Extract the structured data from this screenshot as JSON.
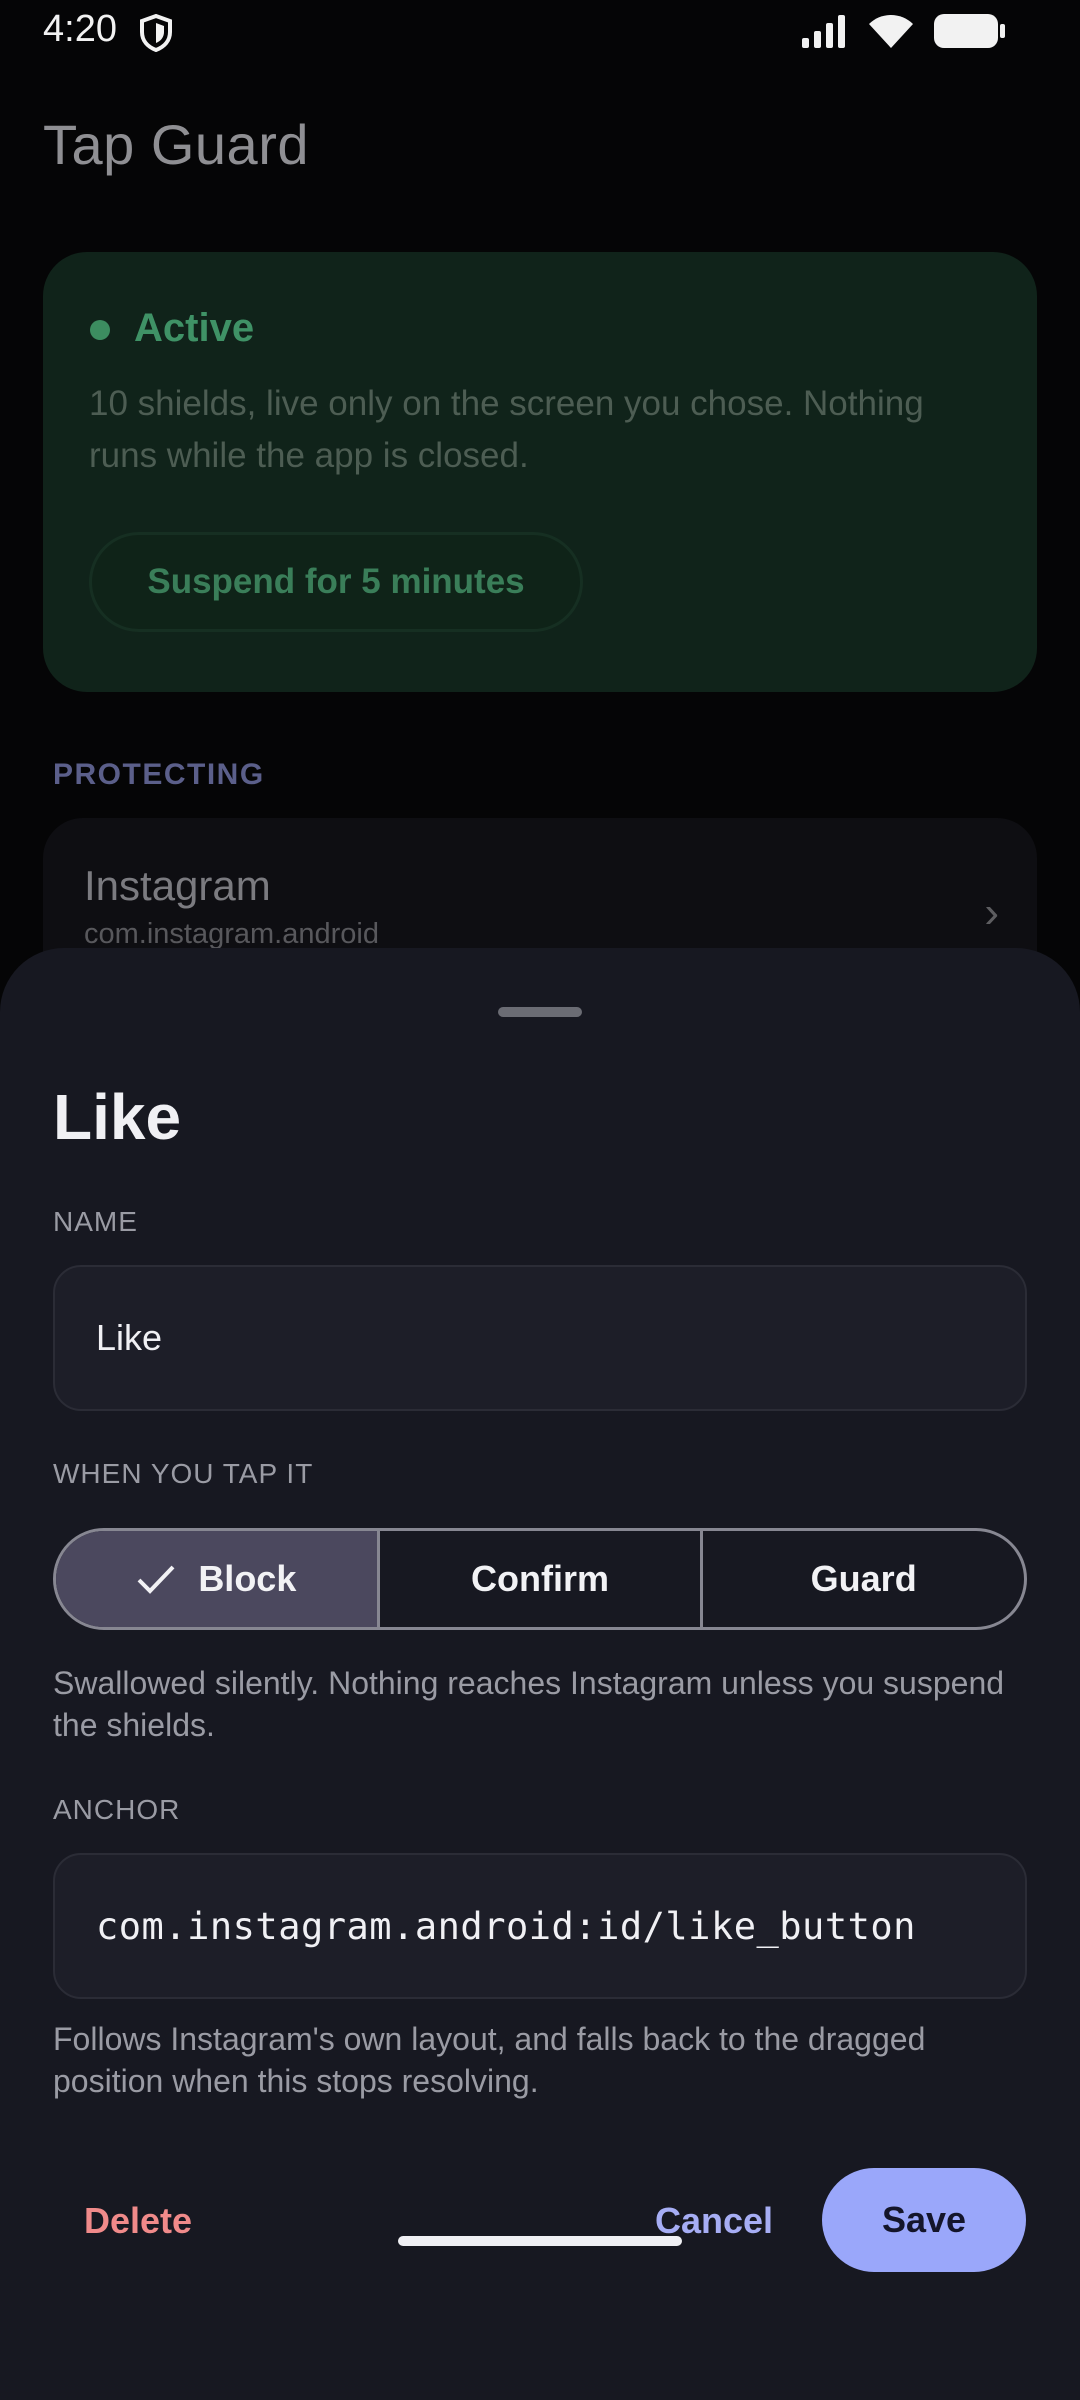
{
  "status_bar": {
    "time": "4:20",
    "left_icon": "shield-icon",
    "right_icons": [
      "signal-icon",
      "wifi-icon",
      "battery-icon"
    ]
  },
  "app": {
    "title": "Tap Guard"
  },
  "status_card": {
    "label": "Active",
    "description": "10 shields, live only on the screen you chose. Nothing runs while the app is closed.",
    "suspend_button": "Suspend for 5 minutes"
  },
  "protecting": {
    "section_label": "PROTECTING",
    "app_name": "Instagram",
    "package": "com.instagram.android"
  },
  "sheet": {
    "title": "Like",
    "name_label": "NAME",
    "name_value": "Like",
    "tap_label": "WHEN YOU TAP IT",
    "options": [
      "Block",
      "Confirm",
      "Guard"
    ],
    "selected_option": "Block",
    "tap_helper": "Swallowed silently. Nothing reaches Instagram unless you suspend the shields.",
    "anchor_label": "ANCHOR",
    "anchor_value": "com.instagram.android:id/like_button",
    "anchor_helper": "Follows Instagram's own layout, and falls back to the dragged position when this stops resolving.",
    "delete_label": "Delete",
    "cancel_label": "Cancel",
    "save_label": "Save"
  },
  "colors": {
    "accent": "#9aa7fa",
    "active_green": "#3f9266",
    "danger": "#f08a8a",
    "sheet_bg": "#171821"
  }
}
